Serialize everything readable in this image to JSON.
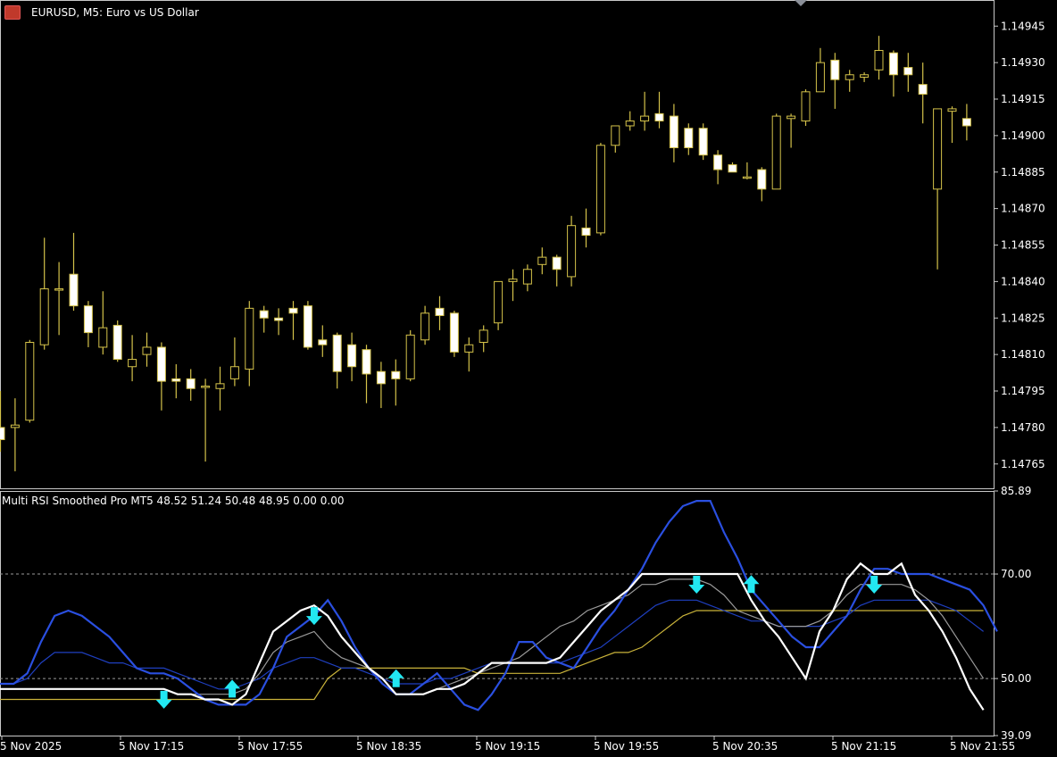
{
  "header": {
    "symbol_label": "EURUSD, M5:  Euro vs US Dollar",
    "icons": [
      "market-watch-icon",
      "trading-icon"
    ]
  },
  "indicator": {
    "label": "Multi RSI Smoothed Pro MT5 48.52 51.24 50.48 48.95 0.00 0.00"
  },
  "colors": {
    "background": "#000000",
    "candle": "#d4c24a",
    "candle_bull_body": "#000000",
    "candle_bear_body": "#ffffff",
    "rsi_fast_blue": "#2a4fe0",
    "rsi_white": "#ffffff",
    "rsi_gray": "#9a9a9a",
    "rsi_slow_blue": "#1f3fbf",
    "rsi_yellow": "#c9b33a",
    "arrow": "#22e8f2",
    "axis": "#c8c8c8",
    "grid_level": "#9a9a9a"
  },
  "chart_data": [
    {
      "type": "candlestick",
      "title": "EURUSD, M5:  Euro vs US Dollar",
      "ylim": [
        1.14755,
        1.14955
      ],
      "y_ticks": [
        "1.14945",
        "1.14930",
        "1.14915",
        "1.14900",
        "1.14885",
        "1.14870",
        "1.14855",
        "1.14840",
        "1.14825",
        "1.14810",
        "1.14795",
        "1.14780",
        "1.14765"
      ],
      "candles": [
        [
          1.1478,
          1.14795,
          1.1477,
          1.14775
        ],
        [
          1.1478,
          1.14792,
          1.14762,
          1.14781
        ],
        [
          1.14783,
          1.14816,
          1.14782,
          1.14815
        ],
        [
          1.14814,
          1.14858,
          1.14812,
          1.14837
        ],
        [
          1.14837,
          1.14848,
          1.14818,
          1.14837
        ],
        [
          1.14843,
          1.1486,
          1.14828,
          1.1483
        ],
        [
          1.1483,
          1.14832,
          1.14813,
          1.14819
        ],
        [
          1.14813,
          1.14836,
          1.1481,
          1.14821
        ],
        [
          1.14822,
          1.14824,
          1.14807,
          1.14808
        ],
        [
          1.14805,
          1.14818,
          1.14799,
          1.14808
        ],
        [
          1.1481,
          1.14819,
          1.14805,
          1.14813
        ],
        [
          1.14813,
          1.14815,
          1.14787,
          1.14799
        ],
        [
          1.148,
          1.14806,
          1.14792,
          1.14799
        ],
        [
          1.148,
          1.14804,
          1.14791,
          1.14796
        ],
        [
          1.14797,
          1.148,
          1.14766,
          1.14797
        ],
        [
          1.14796,
          1.14805,
          1.14787,
          1.14798
        ],
        [
          1.148,
          1.14817,
          1.14797,
          1.14805
        ],
        [
          1.14804,
          1.14832,
          1.14797,
          1.14829
        ],
        [
          1.14828,
          1.1483,
          1.14819,
          1.14825
        ],
        [
          1.14825,
          1.14829,
          1.14818,
          1.14824
        ],
        [
          1.14829,
          1.14832,
          1.14816,
          1.14827
        ],
        [
          1.1483,
          1.14832,
          1.14812,
          1.14813
        ],
        [
          1.14816,
          1.14822,
          1.14809,
          1.14814
        ],
        [
          1.14818,
          1.14819,
          1.14796,
          1.14803
        ],
        [
          1.14814,
          1.14819,
          1.14799,
          1.14805
        ],
        [
          1.14812,
          1.14814,
          1.1479,
          1.14802
        ],
        [
          1.14803,
          1.14807,
          1.14788,
          1.14798
        ],
        [
          1.14803,
          1.14808,
          1.14789,
          1.148
        ],
        [
          1.148,
          1.1482,
          1.14799,
          1.14818
        ],
        [
          1.14816,
          1.1483,
          1.14814,
          1.14827
        ],
        [
          1.14829,
          1.14834,
          1.1482,
          1.14826
        ],
        [
          1.14827,
          1.14828,
          1.14809,
          1.14811
        ],
        [
          1.14811,
          1.14817,
          1.14803,
          1.14814
        ],
        [
          1.14815,
          1.14822,
          1.14811,
          1.1482
        ],
        [
          1.14823,
          1.1484,
          1.1482,
          1.1484
        ],
        [
          1.1484,
          1.14845,
          1.14832,
          1.14841
        ],
        [
          1.14839,
          1.14847,
          1.14836,
          1.14845
        ],
        [
          1.14847,
          1.14854,
          1.14843,
          1.1485
        ],
        [
          1.1485,
          1.14851,
          1.14838,
          1.14845
        ],
        [
          1.14842,
          1.14867,
          1.14838,
          1.14863
        ],
        [
          1.14862,
          1.1487,
          1.14854,
          1.14859
        ],
        [
          1.1486,
          1.14897,
          1.14859,
          1.14896
        ],
        [
          1.14896,
          1.14904,
          1.14893,
          1.14904
        ],
        [
          1.14904,
          1.1491,
          1.14902,
          1.14906
        ],
        [
          1.14906,
          1.14918,
          1.14902,
          1.14908
        ],
        [
          1.14909,
          1.14918,
          1.14903,
          1.14906
        ],
        [
          1.14908,
          1.14913,
          1.14889,
          1.14895
        ],
        [
          1.14903,
          1.14905,
          1.14892,
          1.14895
        ],
        [
          1.14903,
          1.14905,
          1.1489,
          1.14892
        ],
        [
          1.14892,
          1.14894,
          1.1488,
          1.14886
        ],
        [
          1.14888,
          1.14889,
          1.14886,
          1.14885
        ],
        [
          1.14883,
          1.14889,
          1.14882,
          1.14883
        ],
        [
          1.14886,
          1.14887,
          1.14873,
          1.14878
        ],
        [
          1.14878,
          1.14909,
          1.14878,
          1.14908
        ],
        [
          1.14907,
          1.14909,
          1.14895,
          1.14908
        ],
        [
          1.14906,
          1.14919,
          1.14904,
          1.14918
        ],
        [
          1.14918,
          1.14936,
          1.14918,
          1.1493
        ],
        [
          1.14931,
          1.14934,
          1.14911,
          1.14923
        ],
        [
          1.14923,
          1.14927,
          1.14918,
          1.14925
        ],
        [
          1.14924,
          1.14926,
          1.14922,
          1.14925
        ],
        [
          1.14927,
          1.14941,
          1.14923,
          1.14935
        ],
        [
          1.14934,
          1.14935,
          1.14916,
          1.14925
        ],
        [
          1.14928,
          1.14934,
          1.14918,
          1.14925
        ],
        [
          1.14921,
          1.1493,
          1.14905,
          1.14917
        ],
        [
          1.14878,
          1.14911,
          1.14845,
          1.14911
        ],
        [
          1.1491,
          1.14912,
          1.14897,
          1.14911
        ],
        [
          1.14907,
          1.14913,
          1.14898,
          1.14904
        ]
      ]
    },
    {
      "type": "line",
      "title": "Multi RSI Smoothed Pro MT5",
      "ylim": [
        39.09,
        85.89
      ],
      "y_ticks": [
        "85.89",
        "70.00",
        "50.00",
        "39.09"
      ],
      "levels": [
        70,
        50
      ],
      "x_labels": [
        "5 Nov 2025",
        "5 Nov 17:15",
        "5 Nov 17:55",
        "5 Nov 18:35",
        "5 Nov 19:15",
        "5 Nov 19:55",
        "5 Nov 20:35",
        "5 Nov 21:15",
        "5 Nov 21:55"
      ],
      "series": [
        {
          "color": "#2a4fe0",
          "values": [
            49,
            49,
            51,
            57,
            62,
            63,
            62,
            60,
            58,
            55,
            52,
            51,
            51,
            50,
            48,
            46,
            45,
            45,
            45,
            47,
            52,
            58,
            60,
            62,
            65,
            61,
            56,
            52,
            49,
            47,
            47,
            49,
            51,
            48,
            45,
            44,
            47,
            51,
            57,
            57,
            54,
            53,
            52,
            56,
            60,
            63,
            67,
            71,
            76,
            80,
            83,
            84,
            84,
            78,
            73,
            67,
            64,
            61,
            58,
            56,
            56,
            59,
            62,
            67,
            71,
            71,
            70,
            70,
            70,
            69,
            68,
            67,
            64,
            59
          ]
        },
        {
          "color": "#ffffff",
          "values": [
            48,
            48,
            48,
            48,
            48,
            48,
            48,
            48,
            48,
            48,
            48,
            48,
            48,
            47,
            47,
            46,
            46,
            45,
            47,
            53,
            59,
            61,
            63,
            64,
            62,
            58,
            55,
            52,
            50,
            47,
            47,
            47,
            48,
            48,
            49,
            51,
            53,
            53,
            53,
            53,
            53,
            54,
            57,
            60,
            63,
            65,
            67,
            70,
            70,
            70,
            70,
            70,
            70,
            70,
            70,
            65,
            61,
            58,
            54,
            50,
            59,
            63,
            69,
            72,
            70,
            70,
            72,
            66,
            63,
            59,
            54,
            48,
            44
          ]
        },
        {
          "color": "#9a9a9a",
          "values": [
            48,
            48,
            48,
            48,
            48,
            48,
            48,
            48,
            48,
            48,
            48,
            48,
            48,
            47,
            47,
            47,
            47,
            47,
            48,
            51,
            55,
            57,
            58,
            59,
            56,
            54,
            53,
            52,
            49,
            47,
            47,
            47,
            48,
            49,
            50,
            51,
            52,
            53,
            54,
            56,
            58,
            60,
            61,
            63,
            64,
            65,
            66,
            68,
            68,
            69,
            69,
            69,
            68,
            66,
            63,
            62,
            61,
            60,
            60,
            60,
            61,
            63,
            66,
            68,
            68,
            68,
            68,
            67,
            65,
            62,
            58,
            54,
            50
          ]
        },
        {
          "color": "#1f3fbf",
          "values": [
            49,
            49,
            50,
            53,
            55,
            55,
            55,
            54,
            53,
            53,
            52,
            52,
            52,
            51,
            50,
            49,
            48,
            48,
            49,
            50,
            52,
            53,
            54,
            54,
            53,
            52,
            52,
            51,
            50,
            49,
            49,
            49,
            50,
            50,
            51,
            52,
            53,
            53,
            53,
            53,
            53,
            53,
            54,
            55,
            56,
            58,
            60,
            62,
            64,
            65,
            65,
            65,
            64,
            63,
            62,
            61,
            61,
            60,
            60,
            60,
            60,
            61,
            62,
            64,
            65,
            65,
            65,
            65,
            65,
            64,
            63,
            61,
            59
          ]
        },
        {
          "color": "#c9b33a",
          "values": [
            46,
            46,
            46,
            46,
            46,
            46,
            46,
            46,
            46,
            46,
            46,
            46,
            46,
            46,
            46,
            46,
            46,
            46,
            46,
            46,
            46,
            46,
            46,
            46,
            50,
            52,
            52,
            52,
            52,
            52,
            52,
            52,
            52,
            52,
            52,
            51,
            51,
            51,
            51,
            51,
            51,
            51,
            52,
            53,
            54,
            55,
            55,
            56,
            58,
            60,
            62,
            63,
            63,
            63,
            63,
            63,
            63,
            63,
            63,
            63,
            63,
            63,
            63,
            63,
            63,
            63,
            63,
            63,
            63,
            63,
            63,
            63,
            63
          ]
        }
      ],
      "arrows": [
        {
          "x": 12,
          "dir": "down"
        },
        {
          "x": 17,
          "dir": "up"
        },
        {
          "x": 23,
          "dir": "down"
        },
        {
          "x": 29,
          "dir": "up"
        },
        {
          "x": 51,
          "dir": "down"
        },
        {
          "x": 55,
          "dir": "up"
        },
        {
          "x": 64,
          "dir": "down"
        }
      ]
    }
  ]
}
